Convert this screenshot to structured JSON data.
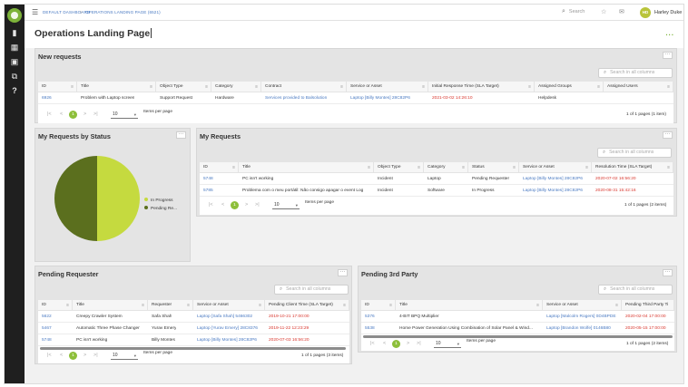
{
  "app": {
    "breadcrumb_home": "DEFAULT DASHBOARD",
    "breadcrumb_sep": ">",
    "breadcrumb_current": "OPERATIONS LANDING PAGE (6521)",
    "search_label": "Search",
    "user_initials": "HD",
    "user_name": "Harley Duke",
    "page_title": "Operations Landing Page",
    "more": "..."
  },
  "colors": {
    "accent": "#8dbf3a",
    "link": "#4a7ac2",
    "overdue": "#d9382f",
    "pie_in_progress": "#c5da3f",
    "pie_pending": "#5b6f1e"
  },
  "icons": [
    "menu-icon",
    "search-icon",
    "star-icon",
    "inbox-icon",
    "bell-icon",
    "chart-icon",
    "grid-icon",
    "layers-icon",
    "external-icon",
    "help-icon"
  ],
  "pager_common": {
    "first": "|<",
    "prev": "<",
    "next": ">",
    "last": ">|",
    "items_per_page": "Items per page",
    "page_size": "10"
  },
  "new_requests": {
    "title": "New requests",
    "search_placeholder": "Search in all columns",
    "columns": [
      "ID",
      "Title",
      "Object Type",
      "Category",
      "Contract",
      "Service or Asset",
      "Initial Response Time (SLA Target)",
      "Assigned Groups",
      "Assigned Users"
    ],
    "rows": [
      [
        "6926",
        "Problem with Laptop screen",
        "Support Request",
        "Hardware",
        "Services provided to Balsolution",
        "Laptop [Billy Montes] 28C82P6",
        "2021-03-02 14:26:10",
        "Helpdesk",
        ""
      ]
    ],
    "page": "1",
    "info": "1 of 1 pages (1 item)"
  },
  "status_chart": {
    "title": "My Requests by Status",
    "chart_data": {
      "type": "pie",
      "categories": [
        "In Progress",
        "Pending Re..."
      ],
      "values": [
        1,
        1
      ],
      "legend": "right"
    }
  },
  "my_requests": {
    "title": "My Requests",
    "search_placeholder": "Search in all columns",
    "columns": [
      "ID",
      "Title",
      "Object Type",
      "Category",
      "Status",
      "Service or Asset",
      "Resolution Time (SLA Target)"
    ],
    "rows": [
      [
        "5748",
        "PC isn't working",
        "Incident",
        "Laptop",
        "Pending Requester",
        "Laptop [Billy Montes] 28C82P6",
        "2020-07-02 16:56:20"
      ],
      [
        "5785",
        "Problema com o meu portátil: Não consigo apagar o event Log",
        "Incident",
        "Software",
        "In Progress",
        "Laptop [Billy Montes] 28C82P6",
        "2020-08-31 15:42:16"
      ]
    ],
    "page": "1",
    "info": "1 of 1 pages (2 items)"
  },
  "pending_requester": {
    "title": "Pending Requester",
    "search_placeholder": "Search in all columns",
    "columns": [
      "ID",
      "Title",
      "Requester",
      "Service or Asset",
      "Pending Client Time (SLA Target)"
    ],
    "rows": [
      [
        "5622",
        "Creepy Crawler System",
        "Safa Shah",
        "Laptop [Safa Shah] 5466302",
        "2019-10-21 17:00:00"
      ],
      [
        "5467",
        "Automatic Three Phase Changer",
        "Yurav Emery",
        "Laptop [Yurav Emery] 28C8376",
        "2019-11-22 12:23:29"
      ],
      [
        "5748",
        "PC isn't working",
        "Billy Montes",
        "Laptop [Billy Montes] 28C82P6",
        "2020-07-03 16:56:20"
      ]
    ],
    "page": "1",
    "info": "1 of 1 pages (3 items)"
  },
  "pending_3rd_party": {
    "title": "Pending 3rd Party",
    "search_placeholder": "Search in all columns",
    "columns": [
      "ID",
      "Title",
      "Service or Asset",
      "Pending Third Party Ti"
    ],
    "rows": [
      [
        "5376",
        "4-BIT BPQ Multiplier",
        "Laptop [Malcolm Rogers] 0D4BPDE",
        "2020-02-04 17:00:00"
      ],
      [
        "5538",
        "Home Power Generation Using Combination of Solar Panel & Wind...",
        "Laptop [Brandon Wolfe] 0146B80",
        "2020-05-15 17:00:00"
      ]
    ],
    "page": "1",
    "info": "1 of 1 pages (2 items)"
  }
}
